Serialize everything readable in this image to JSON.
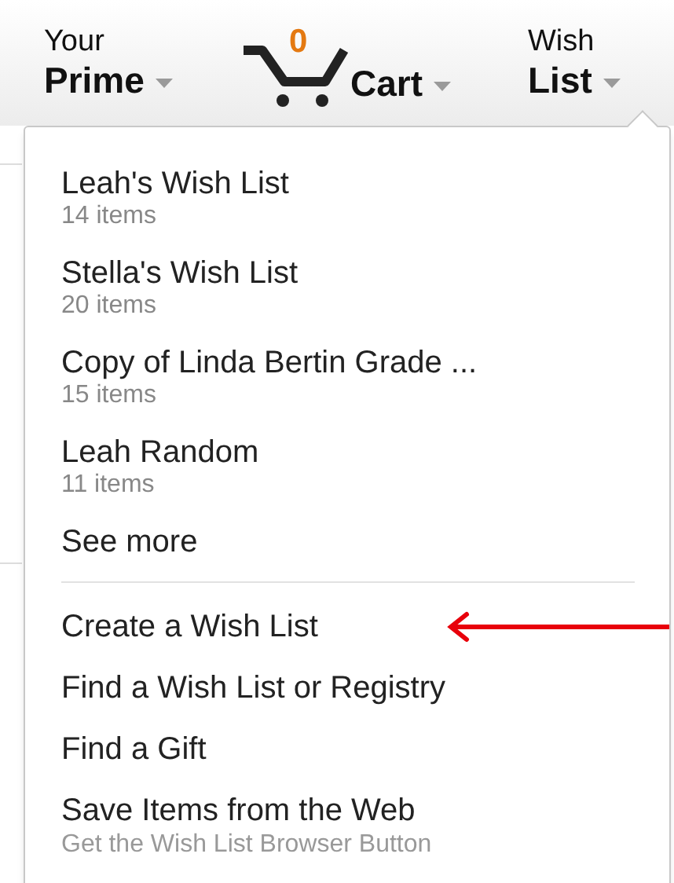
{
  "nav": [
    {
      "kind": "menu",
      "line1": "Your",
      "line2": "Prime"
    },
    {
      "kind": "cart",
      "count": "0",
      "line2": "Cart"
    },
    {
      "kind": "menu",
      "line1": "Wish",
      "line2": "List"
    }
  ],
  "dropdown": {
    "wish_lists": [
      {
        "name": "Leah's Wish List",
        "count": "14 items"
      },
      {
        "name": "Stella's Wish List",
        "count": "20 items"
      },
      {
        "name": "Copy of Linda Bertin Grade ...",
        "count": "15 items"
      },
      {
        "name": "Leah Random",
        "count": "11 items"
      }
    ],
    "see_more": "See more",
    "links": [
      {
        "label": "Create a Wish List",
        "pointed_at": true
      },
      {
        "label": "Find a Wish List or Registry",
        "pointed_at": false
      },
      {
        "label": "Find a Gift",
        "pointed_at": false
      },
      {
        "label": "Save Items from the Web",
        "pointed_at": false,
        "note": "Get the Wish List Browser Button"
      }
    ]
  }
}
